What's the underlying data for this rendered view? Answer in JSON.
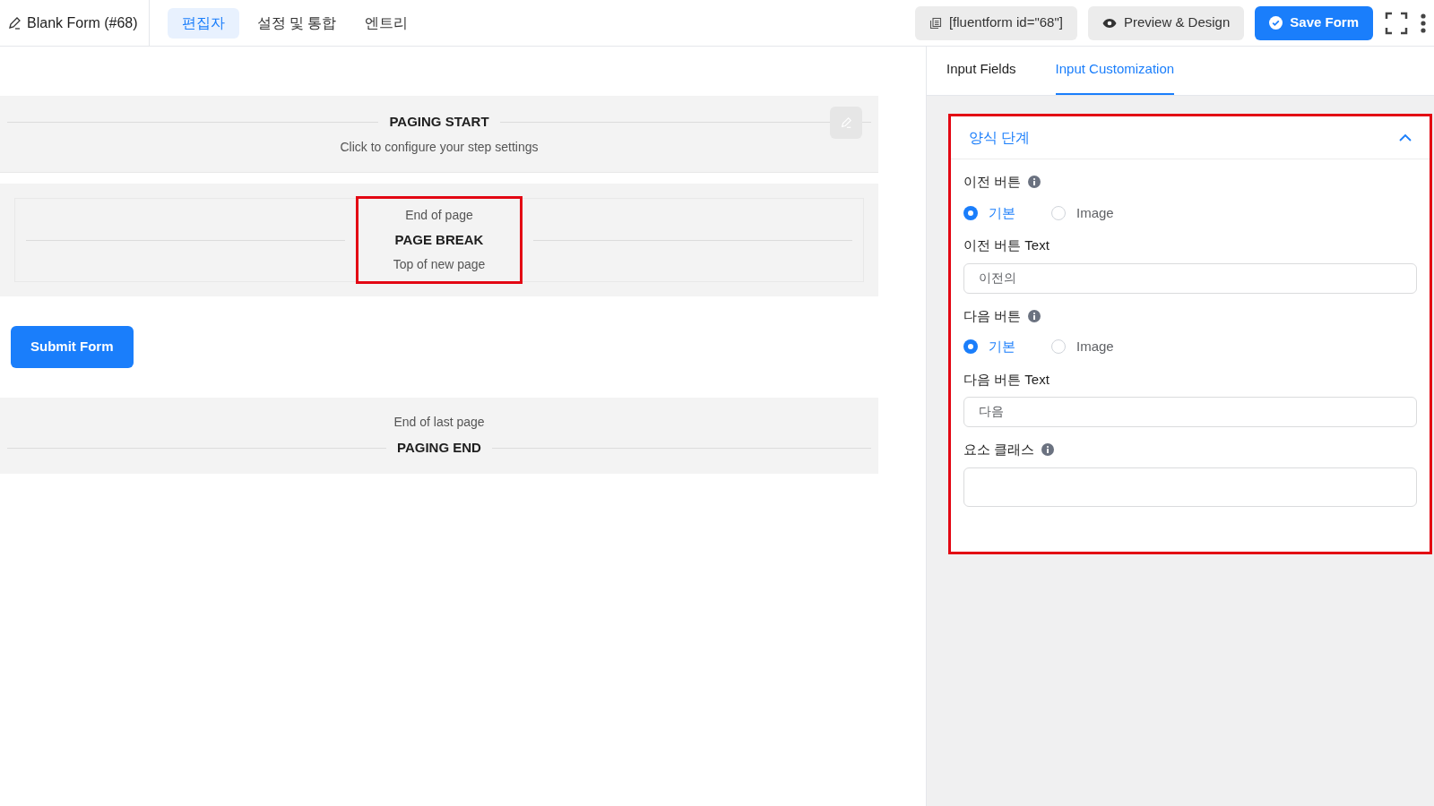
{
  "header": {
    "title": "Blank Form (#68)",
    "tabs": [
      {
        "label": "편집자",
        "selected": true
      },
      {
        "label": "설정 및 통합",
        "selected": false
      },
      {
        "label": "엔트리",
        "selected": false
      }
    ],
    "shortcode": "[fluentform id=\"68\"]",
    "preview_button": "Preview & Design",
    "save_button": "Save Form"
  },
  "canvas": {
    "paging_start": {
      "title": "PAGING START",
      "subtitle": "Click to configure your step settings"
    },
    "page_break": {
      "top": "End of page",
      "title": "PAGE BREAK",
      "bottom": "Top of new page",
      "highlighted": true
    },
    "submit_button": "Submit Form",
    "paging_end": {
      "top": "End of last page",
      "title": "PAGING END"
    }
  },
  "sidebar": {
    "tabs": [
      {
        "label": "Input Fields",
        "selected": false
      },
      {
        "label": "Input Customization",
        "selected": true
      }
    ],
    "section": {
      "title": "양식 단계",
      "expanded": true,
      "highlighted": true,
      "fields": [
        {
          "kind": "radio",
          "label": "이전 버튼",
          "options": [
            {
              "label": "기본",
              "selected": true
            },
            {
              "label": "Image",
              "selected": false
            }
          ]
        },
        {
          "kind": "text",
          "label": "이전 버튼 Text",
          "value": "이전의"
        },
        {
          "kind": "radio",
          "label": "다음 버튼",
          "options": [
            {
              "label": "기본",
              "selected": true
            },
            {
              "label": "Image",
              "selected": false
            }
          ]
        },
        {
          "kind": "text",
          "label": "다음 버튼 Text",
          "value": "다음"
        },
        {
          "kind": "textarea",
          "label": "요소 클래스"
        }
      ]
    }
  }
}
